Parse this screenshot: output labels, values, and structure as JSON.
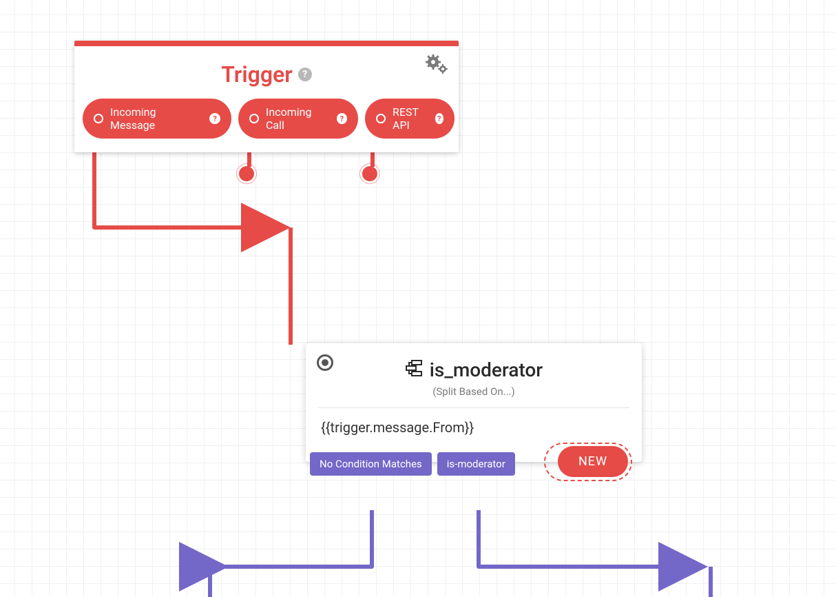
{
  "colors": {
    "red": "#e64b47",
    "purple": "#7367c8",
    "gray_text": "#7a7a7a"
  },
  "trigger": {
    "title": "Trigger",
    "settings_icon": "gears-icon",
    "pills": {
      "incoming_message": "Incoming Message",
      "incoming_call": "Incoming Call",
      "rest_api": "REST API"
    }
  },
  "split_widget": {
    "name": "is_moderator",
    "subtitle": "(Split Based On...)",
    "expression": "{{trigger.message.From}}",
    "outputs": {
      "no_match": "No Condition Matches",
      "is_moderator": "is-moderator"
    },
    "new_label": "NEW"
  }
}
